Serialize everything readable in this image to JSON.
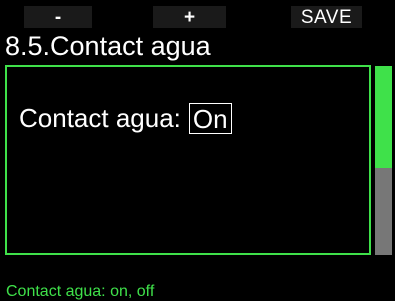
{
  "softkeys": {
    "minus_label": "-",
    "plus_label": "+",
    "save_label": "SAVE"
  },
  "title": "8.5.Contact agua",
  "setting": {
    "label": "Contact agua:",
    "value": "On"
  },
  "scrollbar": {
    "position_fraction": 0.0,
    "visible_fraction": 0.54
  },
  "status_text": "Contact agua: on, off",
  "colors": {
    "accent": "#3fe14a",
    "background": "#000000",
    "softkey_bg": "#1a1a1a",
    "scroll_track": "#777777"
  }
}
